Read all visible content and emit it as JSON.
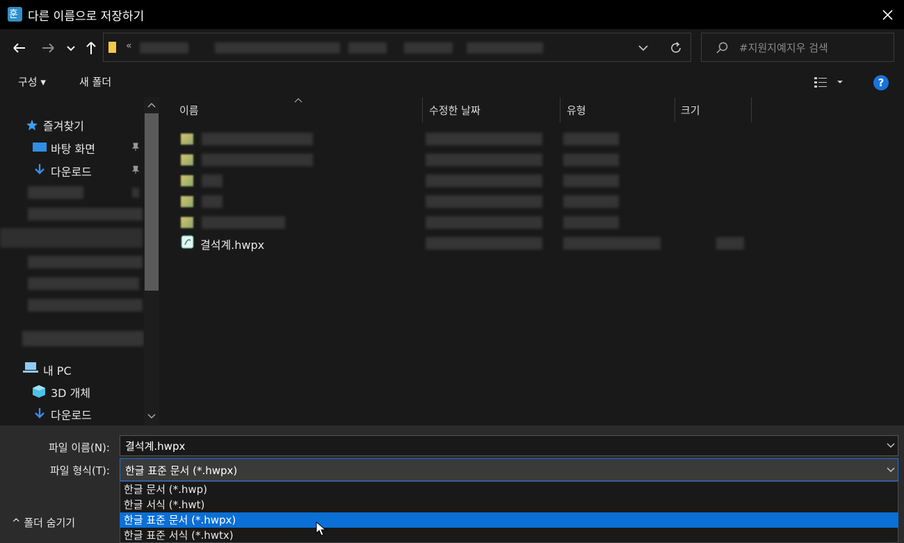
{
  "window": {
    "title": "다른 이름으로 저장하기"
  },
  "nav": {
    "address_prefix": "«",
    "search_placeholder": "#지원지예지우 검색"
  },
  "toolbar": {
    "organize": "구성 ▾",
    "new_folder": "새 폴더",
    "help": "?"
  },
  "sidebar": {
    "favorites": "즐겨찾기",
    "desktop": "바탕 화면",
    "downloads": "다운로드",
    "this_pc": "내 PC",
    "objects_3d": "3D 개체",
    "downloads2": "다운로드"
  },
  "columns": {
    "name": "이름",
    "modified": "수정한 날짜",
    "type": "유형",
    "size": "크기"
  },
  "files": [
    {
      "name": "결석계.hwpx"
    }
  ],
  "save": {
    "filename_label": "파일 이름(N):",
    "filename_value": "결석계.hwpx",
    "filetype_label": "파일 형식(T):",
    "filetype_value": "한글 표준 문서 (*.hwpx)",
    "options": [
      "한글 문서 (*.hwp)",
      "한글 서식 (*.hwt)",
      "한글 표준 문서 (*.hwpx)",
      "한글 표준 서식 (*.hwtx)"
    ],
    "selected_index": 2,
    "hide_folders": "^ 폴더 숨기기"
  }
}
